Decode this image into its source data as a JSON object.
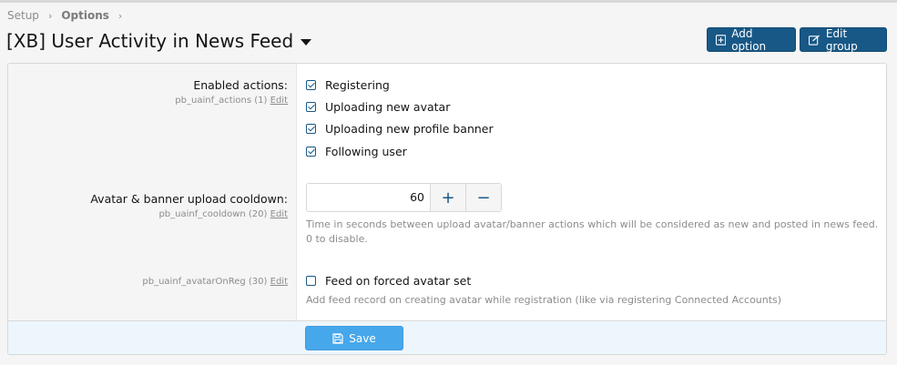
{
  "breadcrumb": {
    "items": [
      "Setup",
      "Options"
    ]
  },
  "page": {
    "title": "[XB] User Activity in News Feed"
  },
  "buttons": {
    "add_option": "Add option",
    "edit_group": "Edit group",
    "save": "Save"
  },
  "options": {
    "actions": {
      "label": "Enabled actions:",
      "meta": "pb_uainf_actions (1)",
      "edit": "Edit",
      "items": [
        {
          "label": "Registering",
          "checked": true
        },
        {
          "label": "Uploading new avatar",
          "checked": true
        },
        {
          "label": "Uploading new profile banner",
          "checked": true
        },
        {
          "label": "Following user",
          "checked": true
        }
      ]
    },
    "cooldown": {
      "label": "Avatar & banner upload cooldown:",
      "meta": "pb_uainf_cooldown (20)",
      "edit": "Edit",
      "value": "60",
      "plus": "+",
      "minus": "−",
      "explain": "Time in seconds between upload avatar/banner actions which will be considered as new and posted in news feed. 0 to disable."
    },
    "avatar_on_reg": {
      "meta": "pb_uainf_avatarOnReg (30)",
      "edit": "Edit",
      "checkbox_label": "Feed on forced avatar set",
      "checked": false,
      "explain": "Add feed record on creating avatar while registration (like via registering Connected Accounts)"
    }
  },
  "colors": {
    "primary": "#185886",
    "save": "#47a7eb",
    "footer_bg": "#edf6fd"
  }
}
